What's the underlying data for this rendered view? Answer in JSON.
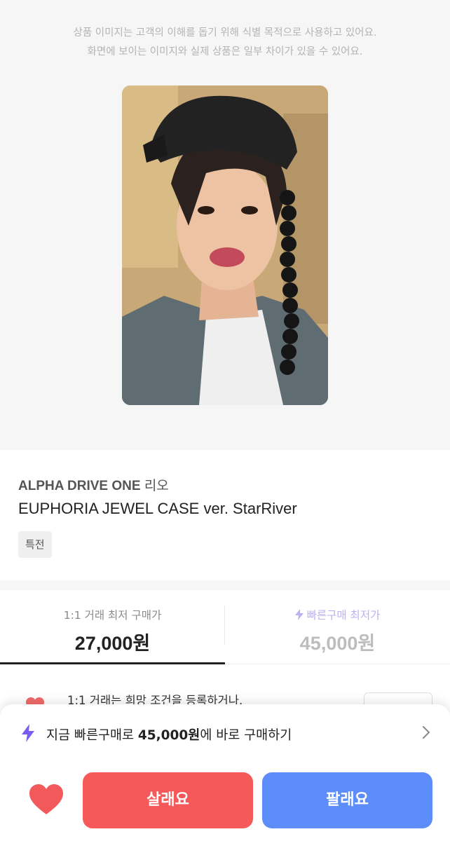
{
  "notice": {
    "line1": "상품 이미지는 고객의 이해를 돕기 위해 식별 목적으로 사용하고 있어요.",
    "line2": "화면에 보이는 이미지와 실제 상품은 일부 차이가 있을 수 있어요."
  },
  "product": {
    "group": "ALPHA DRIVE ONE",
    "member": "리오",
    "album": "EUPHORIA JEWEL CASE ver. StarRiver",
    "tag": "특전"
  },
  "prices": {
    "left_label": "1:1 거래 최저 구매가",
    "left_value": "27,000원",
    "right_label": "빠른구매 최저가",
    "right_value": "45,000원"
  },
  "peek": {
    "text": "1:1 거래는 희망 조건을 등록하거나,"
  },
  "bottom_sheet": {
    "quick_prefix": "지금 빠른구매로 ",
    "quick_price": "45,000원",
    "quick_suffix": "에 바로 구매하기",
    "buy_label": "살래요",
    "sell_label": "팔래요"
  },
  "colors": {
    "buy": "#f6595a",
    "sell": "#5c8dfa",
    "accent_purple": "#7b5cf0"
  }
}
